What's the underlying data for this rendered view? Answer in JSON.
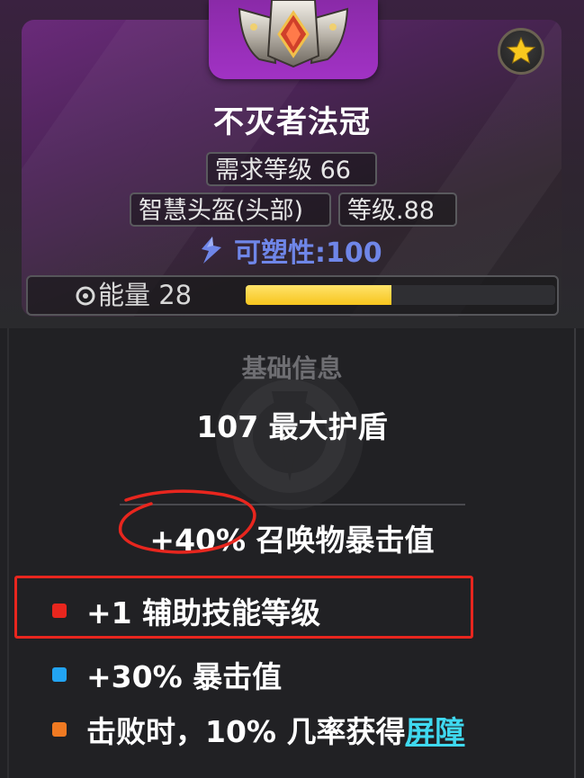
{
  "item": {
    "name": "不灭者法冠",
    "icon": "crown-helmet-icon",
    "rarity_badge_icon": "star-icon",
    "frame_color": "#a132c4"
  },
  "tags": {
    "requirement": "需求等级 66",
    "slot": "智慧头盔(头部)",
    "level": "等级.88"
  },
  "plasticity": {
    "icon": "plasticity-icon",
    "text": "可塑性:100",
    "color": "#6f86e8"
  },
  "energy": {
    "icon": "energy-swirl-icon",
    "label": "能量 28",
    "fill_fraction": 0.47,
    "fill_color": "#f7c51e"
  },
  "base_info": {
    "title": "基础信息",
    "stat": "107 最大护盾"
  },
  "implicit": {
    "text": "+40% 召唤物暴击值"
  },
  "affixes": [
    {
      "text": "+1 辅助技能等级",
      "dot_color": "#e8261e"
    },
    {
      "text": "+30% 暴击值",
      "dot_color": "#22a4f2"
    },
    {
      "text_prefix": "击败时，10% 几率获得",
      "link": "屏障",
      "dot_color": "#f07a22"
    }
  ],
  "annotations": {
    "color": "#e8261e"
  }
}
